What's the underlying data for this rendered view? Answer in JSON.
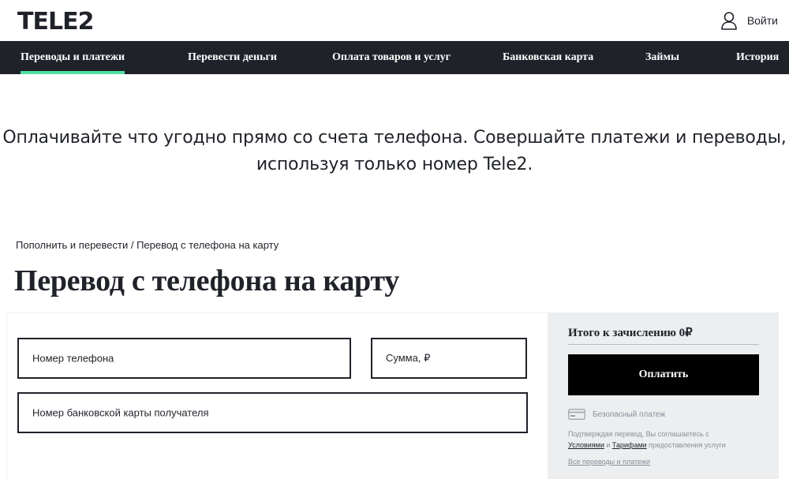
{
  "header": {
    "logo_text": "TELE2",
    "login_label": "Войти",
    "login_icon": "user-icon"
  },
  "nav": {
    "items": [
      {
        "label": "Переводы и платежи",
        "active": true
      },
      {
        "label": "Перевести деньги"
      },
      {
        "label": "Оплата товаров и услуг"
      },
      {
        "label": "Банковская карта"
      },
      {
        "label": "Займы"
      },
      {
        "label": "История"
      }
    ],
    "active_underline_color": "#4fe0a0"
  },
  "intro": {
    "line1": "Оплачивайте что угодно прямо со счета телефона. Совершайте платежи и переводы,",
    "line2": "используя только номер Tele2."
  },
  "breadcrumb": "Пополнить и перевести / Перевод с телефона на карту",
  "page_title": "Перевод с телефона на карту",
  "form": {
    "phone_label": "Номер телефона",
    "sum_label": "Сумма, ₽",
    "card_label": "Номер банковской карты получателя"
  },
  "sidebar": {
    "total_label": "Итого к зачислению 0₽",
    "pay_button": "Оплатить",
    "secure_label": "Безопасный платеж",
    "secure_icon": "card-icon",
    "consent_prefix": "Подтверждая перевод, Вы соглашаетесь с",
    "consent_conditions": "Условиями",
    "consent_and": " и ",
    "consent_tariffs": "Тарифами",
    "consent_suffix": " предоставления услуги",
    "all_link": "Все переводы и платежи"
  },
  "colors": {
    "dark": "#1f2229",
    "sidebar_bg": "#eceef0",
    "muted_text": "#8a8f98"
  }
}
